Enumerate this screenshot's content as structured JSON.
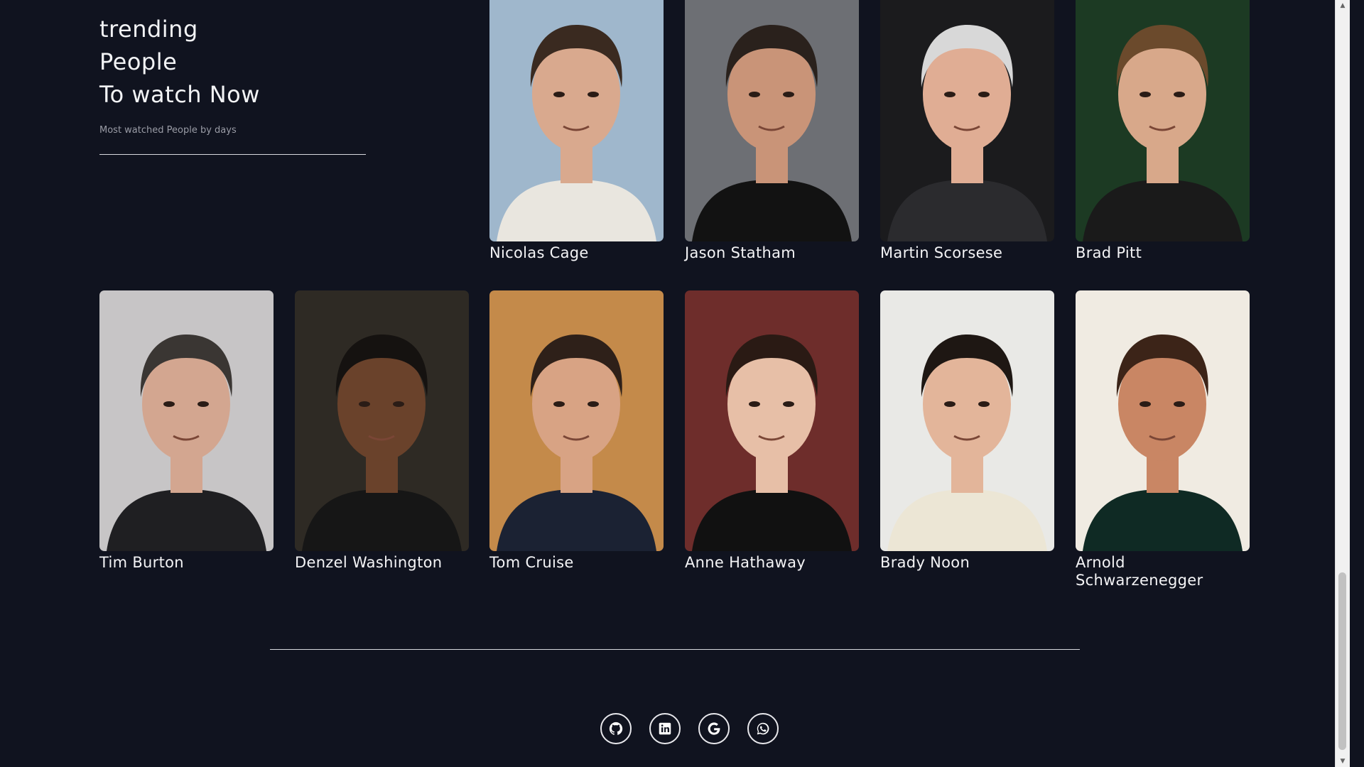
{
  "heading": {
    "line1": "trending",
    "line2": "People",
    "line3": "To watch Now",
    "subtitle": "Most watched People by days"
  },
  "people": [
    {
      "name": "Nicolas Cage",
      "bg": "#9fb7cc",
      "skin": "#d9a98e",
      "hair": "#3a2a20",
      "shirt": "#e9e6df"
    },
    {
      "name": "Jason Statham",
      "bg": "#6d6f74",
      "skin": "#c99478",
      "hair": "#2a211c",
      "shirt": "#121212"
    },
    {
      "name": "Martin Scorsese",
      "bg": "#1b1b1d",
      "skin": "#e0ad94",
      "hair": "#d8d8d8",
      "shirt": "#2b2b2e"
    },
    {
      "name": "Brad Pitt",
      "bg": "#1c3a23",
      "skin": "#d8a88a",
      "hair": "#6b4a2c",
      "shirt": "#1a1a1a"
    },
    {
      "name": "Tim Burton",
      "bg": "#c7c5c6",
      "skin": "#d3a690",
      "hair": "#3a3633",
      "shirt": "#1f1f22"
    },
    {
      "name": "Denzel Washington",
      "bg": "#2e2a24",
      "skin": "#6a422b",
      "hair": "#151210",
      "shirt": "#161616"
    },
    {
      "name": "Tom Cruise",
      "bg": "#c48a4a",
      "skin": "#d8a384",
      "hair": "#2e2019",
      "shirt": "#1b2233"
    },
    {
      "name": "Anne Hathaway",
      "bg": "#6e2d2b",
      "skin": "#e7bfa7",
      "hair": "#2a1a14",
      "shirt": "#111111"
    },
    {
      "name": "Brady Noon",
      "bg": "#e9e9e6",
      "skin": "#e3b59a",
      "hair": "#1e1713",
      "shirt": "#ece6d5"
    },
    {
      "name": "Arnold Schwarzenegger",
      "bg": "#f0ebe2",
      "skin": "#c98664",
      "hair": "#3c2418",
      "shirt": "#0f2a24"
    }
  ],
  "socials": [
    {
      "icon": "github-icon"
    },
    {
      "icon": "linkedin-icon"
    },
    {
      "icon": "google-icon"
    },
    {
      "icon": "whatsapp-icon"
    }
  ]
}
